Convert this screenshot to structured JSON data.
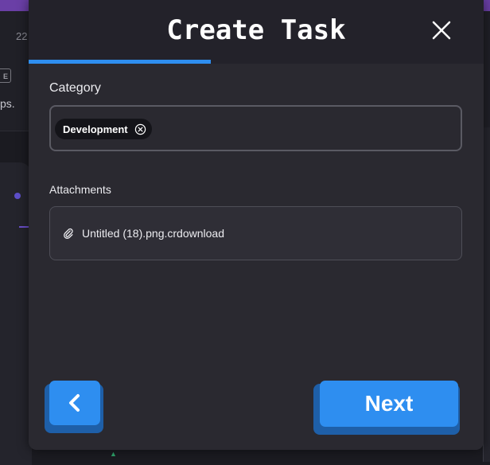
{
  "background": {
    "number": "22",
    "badge": "E",
    "text": "ps."
  },
  "modal": {
    "title": "Create Task",
    "progress_fraction": 0.4,
    "category": {
      "label": "Category",
      "chips": [
        "Development"
      ]
    },
    "attachments": {
      "label": "Attachments",
      "files": [
        "Untitled (18).png.crdownload"
      ]
    },
    "buttons": {
      "back_icon": "chevron-left-icon",
      "next_label": "Next"
    }
  },
  "colors": {
    "accent": "#2e8ef0",
    "modal_bg": "#2a2930",
    "topbar": "#6a3fa6"
  }
}
